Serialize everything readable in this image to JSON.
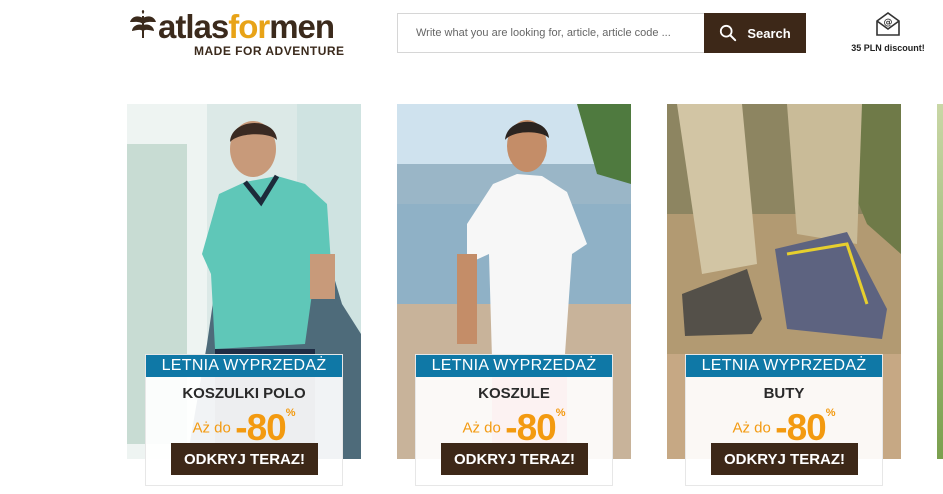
{
  "header": {
    "logo": {
      "name": "atlasformen",
      "tagline": "MADE FOR ADVENTURE"
    },
    "search": {
      "placeholder": "Write what you are looking for, article, article code ...",
      "button_label": "Search"
    },
    "promo": {
      "icon": "envelope-at-icon",
      "text": "35 PLN discount!"
    }
  },
  "cards": [
    {
      "banner": "LETNIA WYPRZEDAŻ",
      "category": "KOSZULKI POLO",
      "up_to": "Aż do",
      "discount": "-80",
      "percent": "%",
      "cta": "ODKRYJ TERAZ!"
    },
    {
      "banner": "LETNIA WYPRZEDAŻ",
      "category": "KOSZULE",
      "up_to": "Aż do",
      "discount": "-80",
      "percent": "%",
      "cta": "ODKRYJ TERAZ!"
    },
    {
      "banner": "LETNIA WYPRZEDAŻ",
      "category": "BUTY",
      "up_to": "Aż do",
      "discount": "-80",
      "percent": "%",
      "cta": "ODKRYJ TERAZ!"
    }
  ],
  "colors": {
    "brand_brown": "#3d2818",
    "accent_orange": "#f39a10",
    "banner_blue": "#0f78a6"
  }
}
